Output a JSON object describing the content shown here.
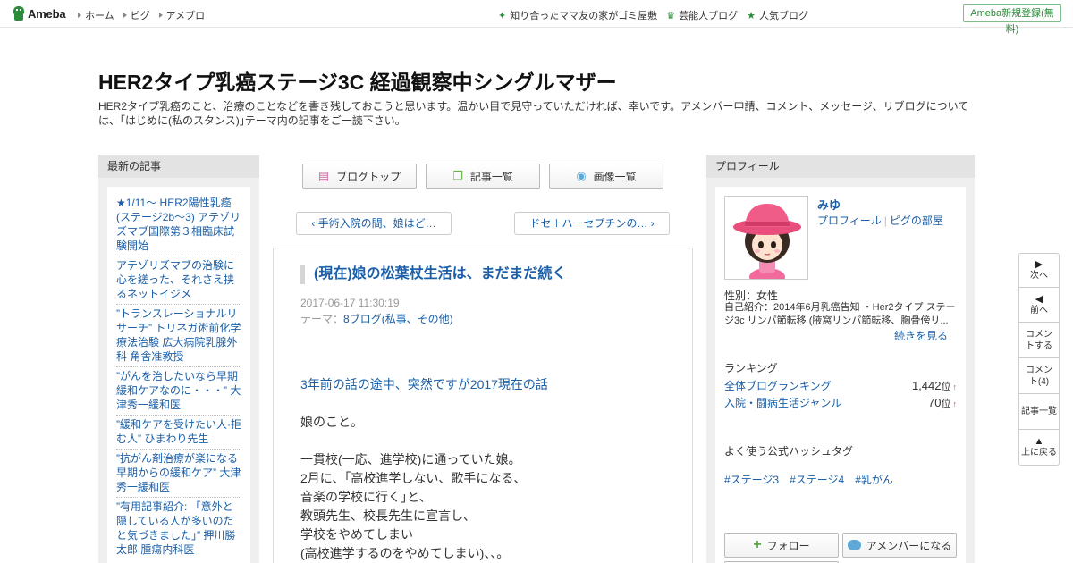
{
  "topbar": {
    "logo": "Ameba",
    "nav": [
      "ホーム",
      "ピグ",
      "アメブロ"
    ],
    "right_links": [
      {
        "icon": "sparkle-icon",
        "label": "知り合ったママ友の家がゴミ屋敷"
      },
      {
        "icon": "crown-icon",
        "label": "芸能人ブログ"
      },
      {
        "icon": "star-icon",
        "label": "人気ブログ"
      }
    ],
    "signup": "Ameba新規登録(無料)"
  },
  "header": {
    "title": "HER2タイプ乳癌ステージ3C 経過観察中シングルマザー",
    "description": "HER2タイプ乳癌のこと、治療のことなどを書き残しておこうと思います。温かい目で見守っていただければ、幸いです。アメンバー申請、コメント、メッセージ、リブログについては、｢はじめに(私のスタンス)｣テーマ内の記事をご一読下さい。"
  },
  "left": {
    "heading": "最新の記事",
    "items": [
      "★1/11～ HER2陽性乳癌(ステージ2b～3) アテゾリズマブ国際第３相臨床試験開始",
      "アテゾリズマブの治験に心を縒った、それさえ挟るネットイジメ",
      "”トランスレーショナルリサーチ” トリネガ術前化学療法治験 広大病院乳腺外科 角舎准教授",
      "”がんを治したいなら早期緩和ケアなのに・・・” 大津秀一緩和医",
      "”緩和ケアを受けたい人·拒む人” ひまわり先生",
      "”抗がん剤治療が楽になる早期からの緩和ケア” 大津秀一緩和医",
      "”有用記事紹介: 「意外と隠している人が多いのだと気づきました」” 押川勝太郎 腫瘍内科医"
    ]
  },
  "center": {
    "buttons": [
      {
        "icon": "page-icon",
        "label": "ブログトップ"
      },
      {
        "icon": "copy-icon",
        "label": "記事一覧"
      },
      {
        "icon": "camera-icon",
        "label": "画像一覧"
      }
    ],
    "prev": "手術入院の間、娘はど…",
    "next": "ドセ＋ハーセプチンの…",
    "entry": {
      "title": "(現在)娘の松葉杖生活は、まだまだ続く",
      "date": "2017-06-17 11:30:19",
      "theme_label": "テーマ：",
      "theme": "8ブログ(私事、その他)",
      "lines": [
        "3年前の話の途中、突然ですが2017現在の話",
        "",
        "娘のこと。",
        "",
        "一貫校(一応、進学校)に通っていた娘。",
        "2月に、｢高校進学しない、歌手になる、",
        "音楽の学校に行く｣と、",
        "教頭先生、校長先生に宣言し、",
        "学校をやめてしまい",
        "(高校進学するのをやめてしまい)、、。"
      ]
    }
  },
  "right": {
    "heading": "プロフィール",
    "name": "みゆ",
    "link1": "プロフィール",
    "link2": "ピグの部屋",
    "gender": "性別：女性",
    "intro": "自己紹介：2014年6月乳癌告知 ・Her2タイプ ステージ3c リンパ節転移 (腋窩リンパ節転移、胸骨傍リ...",
    "more": "続きを見る",
    "ranking_heading": "ランキング",
    "rankings": [
      {
        "label": "全体ブログランキング",
        "value": "1,442",
        "unit": "位",
        "arrow": "↑"
      },
      {
        "label": "入院・闘病生活ジャンル",
        "value": "70",
        "unit": "位",
        "arrow": "↑"
      }
    ],
    "hashtag_heading": "よく使う公式ハッシュタグ",
    "hashtags": [
      "#ステージ3",
      "#ステージ4",
      "#乳がん"
    ],
    "follow": "フォロー",
    "member": "アメンバーになる"
  },
  "float_nav": [
    {
      "icon": "play-right-icon",
      "label": "次へ"
    },
    {
      "icon": "play-left-icon",
      "label": "前へ"
    },
    {
      "icon": "",
      "label": "コメントする"
    },
    {
      "icon": "",
      "label": "コメント(4)"
    },
    {
      "icon": "",
      "label": "記事一覧"
    },
    {
      "icon": "triangle-up-icon",
      "label": "上に戻る"
    }
  ],
  "colors": {
    "link": "#1a5fa8",
    "brand_green": "#2d8c3c"
  }
}
